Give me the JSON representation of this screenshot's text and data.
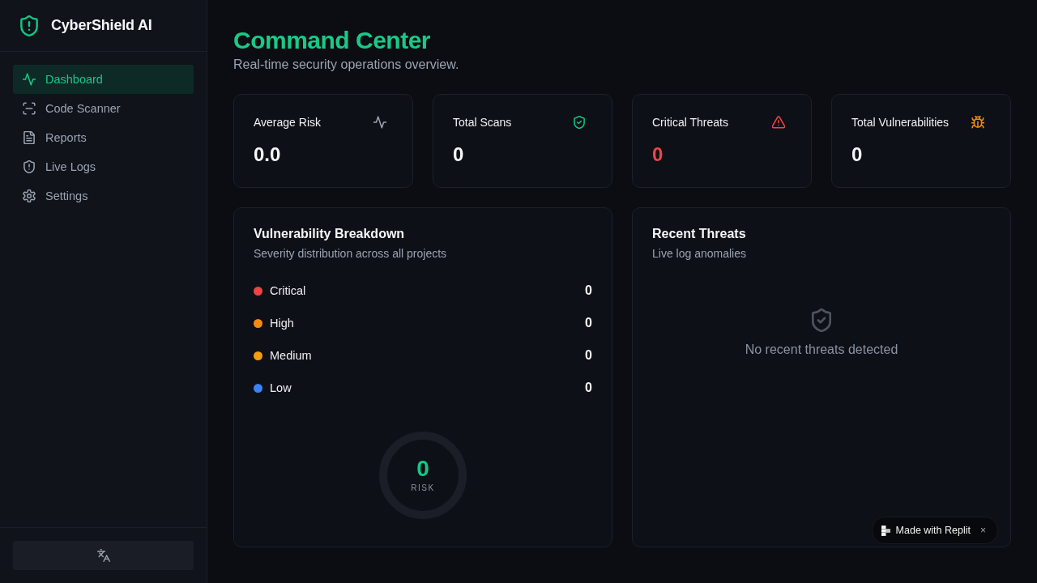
{
  "sidebar": {
    "brand": "CyberShield AI",
    "nav": [
      {
        "label": "Dashboard",
        "selected": true
      },
      {
        "label": "Code Scanner",
        "selected": false
      },
      {
        "label": "Reports",
        "selected": false
      },
      {
        "label": "Live Logs",
        "selected": false
      },
      {
        "label": "Settings",
        "selected": false
      }
    ]
  },
  "header": {
    "title": "Command Center",
    "subtitle": "Real-time security operations overview."
  },
  "stats": [
    {
      "label": "Average Risk",
      "value": "0.0",
      "color": "#9ca3af",
      "emphasis": false
    },
    {
      "label": "Total Scans",
      "value": "0",
      "color": "#10c980",
      "emphasis": false
    },
    {
      "label": "Critical Threats",
      "value": "0",
      "color": "#ef4444",
      "emphasis": true
    },
    {
      "label": "Total Vulnerabilities",
      "value": "0",
      "color": "#f58a0b",
      "emphasis": false
    }
  ],
  "breakdown": {
    "title": "Vulnerability Breakdown",
    "subtitle": "Severity distribution across all projects",
    "rows": [
      {
        "label": "Critical",
        "count": "0",
        "color": "#ef4444"
      },
      {
        "label": "High",
        "count": "0",
        "color": "#f78a0c"
      },
      {
        "label": "Medium",
        "count": "0",
        "color": "#f59e0b"
      },
      {
        "label": "Low",
        "count": "0",
        "color": "#3b82f6"
      }
    ],
    "gauge": {
      "value": "0",
      "label": "RISK"
    }
  },
  "recent_threats": {
    "title": "Recent Threats",
    "subtitle": "Live log anomalies",
    "empty_message": "No recent threats detected"
  },
  "badge": {
    "text": "Made with Replit",
    "close": "×"
  }
}
